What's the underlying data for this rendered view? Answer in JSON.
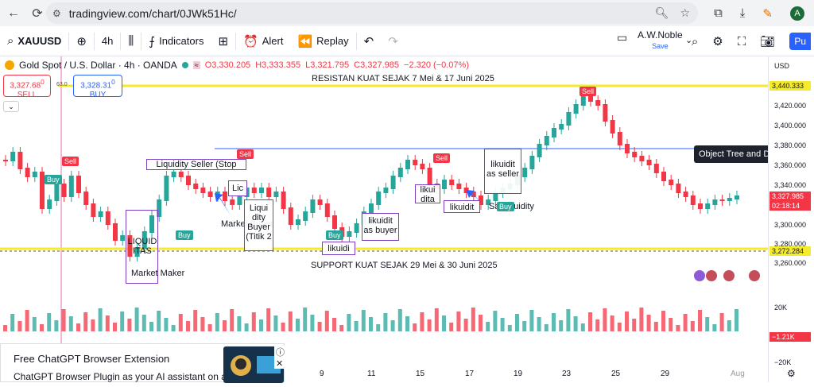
{
  "browser": {
    "url": "tradingview.com/chart/0JWk51Hc/",
    "avatar_letter": "A"
  },
  "toolbar": {
    "symbol": "XAUUSD",
    "interval": "4h",
    "indicators_label": "Indicators",
    "alert_label": "Alert",
    "replay_label": "Replay",
    "user_name": "A.W.Noble",
    "save_label": "Save",
    "publish_label": "Pu"
  },
  "legend": {
    "title": "Gold Spot / U.S. Dollar · 4h · OANDA",
    "open": "O3,330.205",
    "high": "H3,333.355",
    "low": "L3,321.795",
    "close": "C3,327.985",
    "change": "−2.320 (−0.07%)",
    "sell_price": "3,327.68",
    "sell_sup": "0",
    "sell_label": "SELL",
    "buy_price": "3,328.31",
    "buy_sup": "0",
    "buy_label": "BUY",
    "spread": "63.0"
  },
  "currency": "USD",
  "annotations": {
    "resistance": "RESISTAN KUAT SEJAK 7 Mei & 17 Juni 2025",
    "support": "SUPPORT KUAT SEJAK 29 Mei & 30 Juni 2025",
    "liquidity_seller_stop": "Liquidity Seller (Stop",
    "liquid_itas": "LIQUID ITAS",
    "market_maker": "Market Maker",
    "market_buyer": "Market Buyer",
    "lic": "Lic",
    "liquidity_buyer_titik2": "Liqui dity Buyer (Titik 2",
    "likuidi": "likuidi",
    "likuidit_as_buyer": "likuidit as buyer",
    "likui_dita": "likui dita",
    "likuidit": "likuidit",
    "likuidit_as_seller": "likuidit as seller",
    "sa_liquidity": "Sa Liquidity"
  },
  "signals": {
    "sell": "Sell",
    "buy": "Buy"
  },
  "tooltip": "Object Tree and Data Window",
  "price_axis": {
    "labels": [
      "3,420.000",
      "3,400.000",
      "3,380.000",
      "3,360.000",
      "3,340.000",
      "3,300.000",
      "3,280.000",
      "3,260.000"
    ],
    "resistance_tag": "3,440.333",
    "current_tag": "3,327.985",
    "countdown": "02:18:14",
    "support_tag": "3,272.284",
    "vol_label": "20K",
    "vol_tag": "−1.21K",
    "vol_low": "−20K"
  },
  "time_axis": [
    "9",
    "11",
    "15",
    "17",
    "19",
    "23",
    "25",
    "29",
    "Aug"
  ],
  "ad": {
    "title": "Free ChatGPT Browser Extension",
    "subtitle": "ChatGPT Browser Plugin as your AI assistant on any"
  },
  "colors": {
    "up": "#26a69a",
    "down": "#f23645",
    "resistance_line": "#f5ea2b",
    "support_line": "#f5ea2b",
    "blue_line": "#2962ff",
    "annotation_border": "#7b3fbf"
  }
}
